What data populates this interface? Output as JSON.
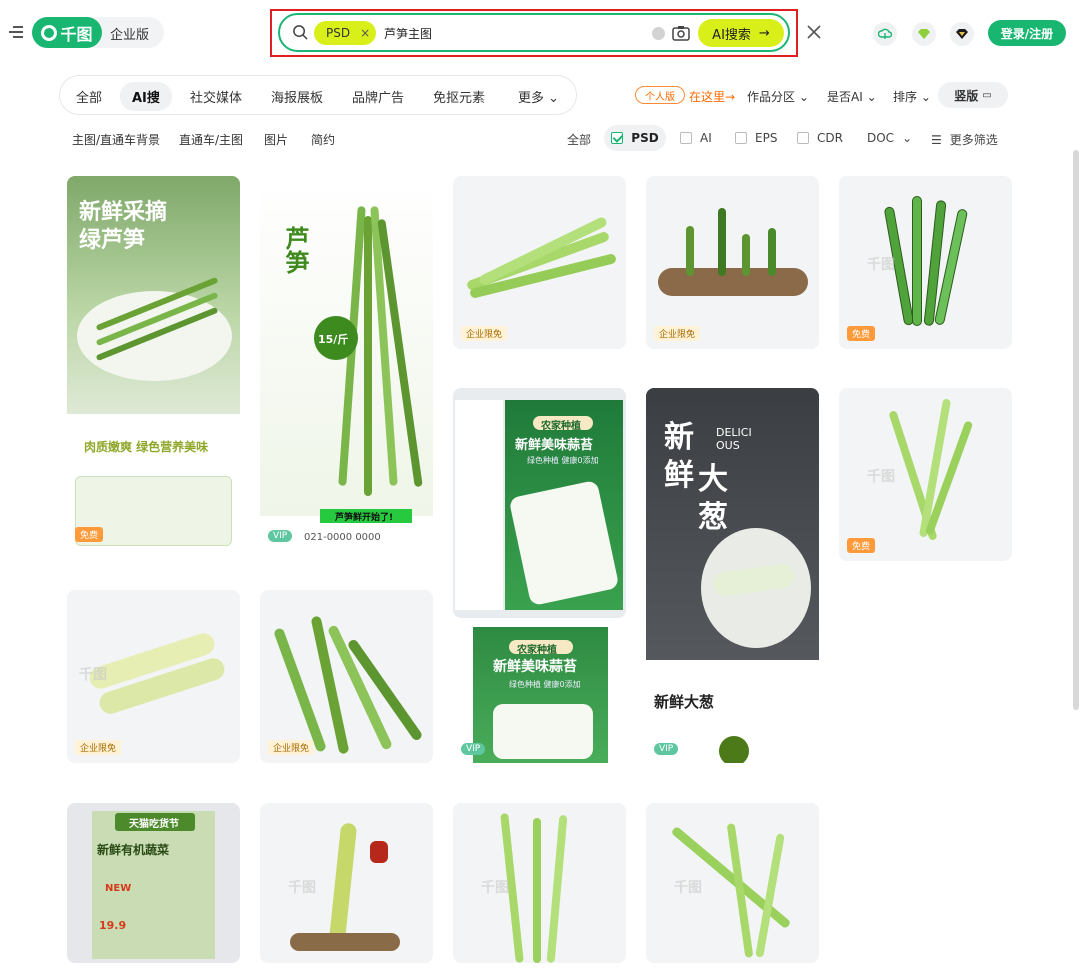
{
  "header": {
    "logo_text": "千图",
    "enterprise_label": "企业版",
    "search": {
      "tag": "PSD",
      "tag_close": "×",
      "query": "芦笋主图",
      "ai_button": "AI搜索",
      "ai_arrow": "→"
    },
    "login_label": "登录/注册"
  },
  "categories": [
    "全部",
    "AI搜",
    "社交媒体",
    "海报展板",
    "品牌广告",
    "免抠元素",
    "更多"
  ],
  "right_filters": {
    "personal_badge": "个人版",
    "here_link": "在这里→",
    "works_zone": "作品分区",
    "is_ai": "是否AI",
    "sort": "排序",
    "layout": "竖版"
  },
  "sub_links": [
    "主图/直通车背景",
    "直通车/主图",
    "图片",
    "简约"
  ],
  "formats": {
    "all": "全部",
    "psd": "PSD",
    "ai": "AI",
    "eps": "EPS",
    "cdr": "CDR",
    "doc": "DOC",
    "more": "更多筛选"
  },
  "cards": {
    "c1": {
      "title_1": "新鲜采摘",
      "title_2": "绿芦笋",
      "sub": "肉质嫩爽 绿色营养美味",
      "badge": "免费"
    },
    "c2": {
      "title": "芦笋",
      "price": "15/斤",
      "phone": "021-0000 0000",
      "banner": "芦笋鲜开始了!",
      "badge": "VIP"
    },
    "c3": {
      "badge": "企业限免"
    },
    "c4": {
      "badge": "企业限免"
    },
    "c5": {
      "badge": "免费"
    },
    "c6": {
      "tag": "农家种植",
      "title": "新鲜美味蒜苔",
      "sub": "绿色种植 健康0添加"
    },
    "c6b": {
      "tag": "农家种植",
      "title": "新鲜美味蒜苔",
      "sub": "绿色种植 健康0添加",
      "badge": "VIP"
    },
    "c7": {
      "title_1": "新",
      "title_2": "鲜",
      "title_3": "大",
      "title_4": "葱",
      "en": "DELICI OUS",
      "bottom": "新鲜大葱",
      "badge": "VIP"
    },
    "c8": {
      "badge": "免费"
    },
    "c9": {
      "badge": "企业限免"
    },
    "c10": {
      "badge": "企业限免"
    },
    "c11": {
      "top": "天猫吃货节",
      "title": "新鲜有机蔬菜",
      "new": "NEW",
      "price": "19.9"
    },
    "watermark": "千图"
  }
}
